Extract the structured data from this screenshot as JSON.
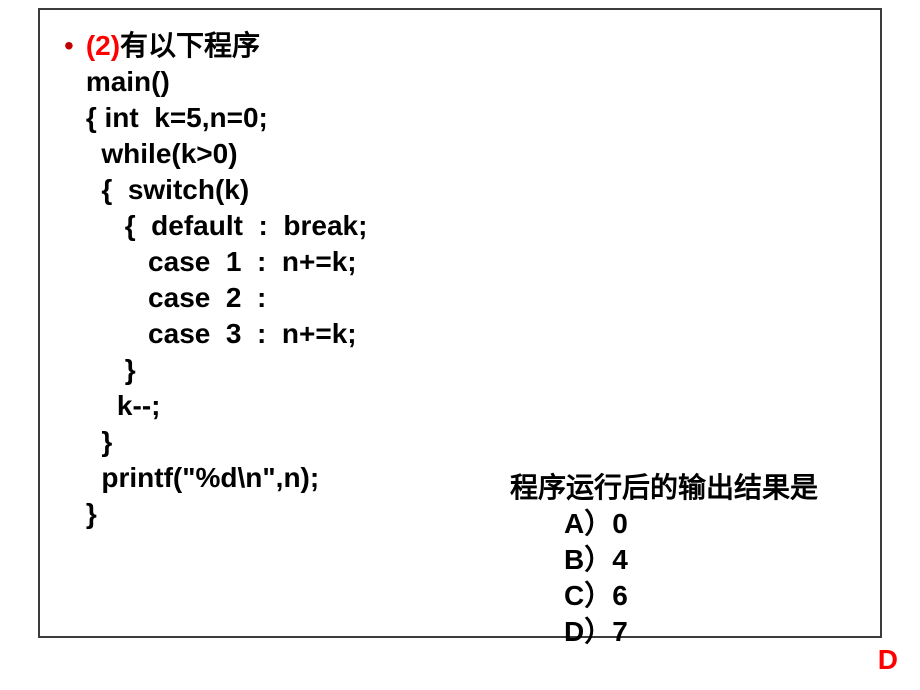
{
  "bullet": "•",
  "tag": "(2)",
  "title_text": "有以下程序",
  "code": {
    "l1": "main()",
    "l2": "{ int  k=5,n=0;",
    "l3": "  while(k>0)",
    "l4": "  {  switch(k)",
    "l5": "     {  default  :  break;",
    "l6": "        case  1  :  n+=k;",
    "l7": "        case  2  :",
    "l8": "        case  3  :  n+=k;",
    "l9": "     }",
    "l10": "    k--;",
    "l11": "  }",
    "l12": "  printf(\"%d\\n\",n);",
    "l13": "}"
  },
  "question_prompt": "程序运行后的输出结果是",
  "options": {
    "a": "A）0",
    "b": "B）4",
    "c": "C）6",
    "d": "D）7"
  },
  "answer": "D"
}
